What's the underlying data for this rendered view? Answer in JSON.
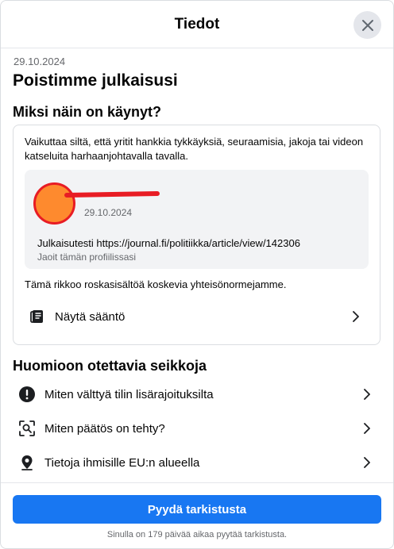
{
  "header": {
    "title": "Tiedot",
    "close_icon": "close-icon"
  },
  "notice": {
    "date": "29.10.2024",
    "title": "Poistimme julkaisusi"
  },
  "why": {
    "heading": "Miksi näin on käynyt?",
    "description": "Vaikuttaa siltä, että yritit hankkia tykkäyksiä, seuraamisia, jakoja tai videon katseluita harhaanjohtavalla tavalla.",
    "post": {
      "date": "29.10.2024",
      "text": "Julkaisutesti https://journal.fi/politiikka/article/view/142306",
      "sub": "Jaoit tämän profiilissasi"
    },
    "rule_text": "Tämä rikkoo roskasisältöä koskevia yhteisönormejamme.",
    "rule_link": {
      "label": "Näytä sääntö",
      "icon": "book-icon"
    }
  },
  "considerations": {
    "heading": "Huomioon otettavia seikkoja",
    "items": [
      {
        "label": "Miten välttyä tilin lisärajoituksilta",
        "icon": "exclamation-circle-icon"
      },
      {
        "label": "Miten päätös on tehty?",
        "icon": "person-scan-icon"
      },
      {
        "label": "Tietoja ihmisille EU:n alueella",
        "icon": "location-pin-icon"
      }
    ]
  },
  "footer": {
    "button_label": "Pyydä tarkistusta",
    "note": "Sinulla on 179 päivää aikaa pyytää tarkistusta."
  },
  "colors": {
    "primary": "#1877f2",
    "secondary_text": "#65676b",
    "avatar_fill": "#fe8a2e",
    "redaction": "#e81c24"
  }
}
